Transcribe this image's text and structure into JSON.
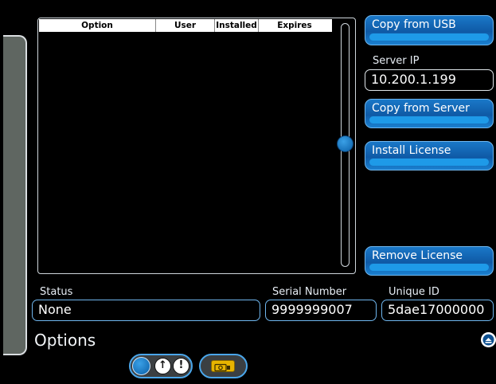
{
  "table": {
    "columns": [
      "Option",
      "User",
      "Installed",
      "Expires"
    ],
    "rows": []
  },
  "buttons": {
    "copy_usb": "Copy from USB",
    "copy_server": "Copy from Server",
    "install": "Install License",
    "remove": "Remove License"
  },
  "server_ip": {
    "label": "Server IP",
    "value": "10.200.1.199"
  },
  "status": {
    "label": "Status",
    "value": "None"
  },
  "serial": {
    "label": "Serial Number",
    "value": "9999999007"
  },
  "unique_id": {
    "label": "Unique ID",
    "value": "5dae17000000"
  },
  "page_title": "Options",
  "toggle_icons": [
    "up-arrow-icon",
    "exclamation-icon"
  ],
  "colors": {
    "accent": "#1a78c8",
    "highlight": "#6fb6ee",
    "usb": "#e7b400"
  }
}
